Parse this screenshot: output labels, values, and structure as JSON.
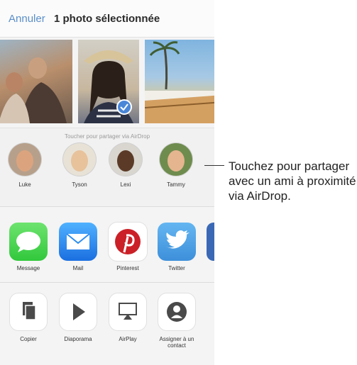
{
  "header": {
    "cancel_label": "Annuler",
    "title": "1 photo sélectionnée"
  },
  "airdrop": {
    "hint": "Toucher pour partager via AirDrop",
    "people": [
      "Luke",
      "Tyson",
      "Lexi",
      "Tammy"
    ]
  },
  "share_apps": [
    "Message",
    "Mail",
    "Pinterest",
    "Twitter"
  ],
  "actions": [
    "Copier",
    "Diaporama",
    "AirPlay",
    "Assigner à un contact"
  ],
  "callout": "Touchez pour partager avec un ami à proximité via AirDrop.",
  "colors": {
    "accent": "#5a8ec9",
    "message": "#4cd964",
    "mail": "#2d8cf0",
    "pinterest": "#cb2027",
    "twitter": "#55acee"
  }
}
